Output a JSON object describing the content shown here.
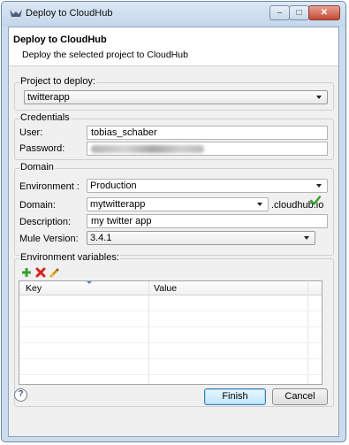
{
  "window": {
    "title": "Deploy to CloudHub",
    "controls": {
      "minimize_icon": "minimize-icon",
      "maximize_icon": "maximize-icon",
      "close_icon": "close-icon"
    }
  },
  "banner": {
    "title": "Deploy to CloudHub",
    "description": "Deploy the selected project to CloudHub"
  },
  "project": {
    "group_title": "Project to deploy:",
    "selected": "twitterapp"
  },
  "credentials": {
    "group_title": "Credentials",
    "user_label": "User:",
    "user_value": "tobias_schaber",
    "password_label": "Password:"
  },
  "domain": {
    "group_title": "Domain",
    "environment_label": "Environment :",
    "environment_value": "Production",
    "domain_label": "Domain:",
    "domain_value": "mytwitterapp",
    "domain_suffix": ".cloudhub.io",
    "description_label": "Description:",
    "description_value": "my twitter app",
    "mule_version_label": "Mule Version:",
    "mule_version_value": "3.4.1"
  },
  "env_vars": {
    "group_title": "Environment variables:",
    "toolbar": [
      "add-icon",
      "remove-icon",
      "edit-icon"
    ],
    "columns": [
      "Key",
      "Value"
    ],
    "rows": []
  },
  "footer": {
    "help_icon": "help-icon",
    "help_glyph": "?",
    "finish_label": "Finish",
    "cancel_label": "Cancel"
  },
  "colors": {
    "accent": "#3c7fb1",
    "add_icon": "#3aa034",
    "remove_icon": "#d8231c",
    "valid_check": "#3aa034"
  }
}
